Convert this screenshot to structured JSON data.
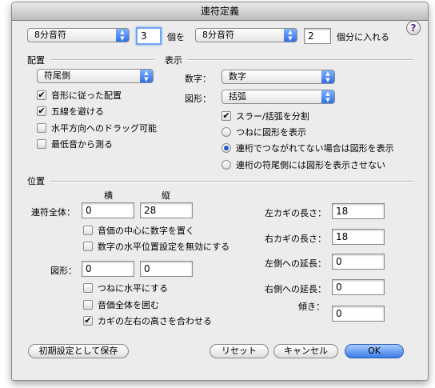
{
  "window": {
    "title": "連符定義"
  },
  "top": {
    "popup1": "8分音符",
    "field1": "3",
    "label_ko": "個を",
    "popup2": "8分音符",
    "field2": "2",
    "label_kobun": "個分に入れる"
  },
  "placement": {
    "header": "配置",
    "popup": "符尾側",
    "checks": [
      {
        "label": "音形に従った配置",
        "checked": true
      },
      {
        "label": "五線を避ける",
        "checked": true
      },
      {
        "label": "水平方向へのドラッグ可能",
        "checked": false
      },
      {
        "label": "最低音から測る",
        "checked": false
      }
    ]
  },
  "display": {
    "header": "表示",
    "number_label": "数字：",
    "number_value": "数字",
    "shape_label": "図形：",
    "shape_value": "括弧",
    "slur_check": {
      "label": "スラー/括弧を分割",
      "checked": true
    },
    "radios": [
      {
        "label": "つねに図形を表示",
        "selected": false
      },
      {
        "label": "連桁でつながれてない場合は図形を表示",
        "selected": true
      },
      {
        "label": "連桁の符尾側には図形を表示させない",
        "selected": false
      }
    ]
  },
  "position": {
    "header": "位置",
    "col_h": "横",
    "col_v": "縦",
    "whole_label": "連符全体：",
    "whole_h": "0",
    "whole_v": "28",
    "whole_checks": [
      {
        "label": "音価の中心に数字を置く",
        "checked": false
      },
      {
        "label": "数字の水平位置設定を無効にする",
        "checked": false
      }
    ],
    "shape_label": "図形：",
    "shape_h": "0",
    "shape_v": "0",
    "shape_checks": [
      {
        "label": "つねに水平にする",
        "checked": false
      },
      {
        "label": "音価全体を囲む",
        "checked": false
      },
      {
        "label": "カギの左右の高さを合わせる",
        "checked": true
      }
    ],
    "left_hook_label": "左カギの長さ：",
    "left_hook": "18",
    "right_hook_label": "右カギの長さ：",
    "right_hook": "18",
    "left_ext_label": "左側への延長：",
    "left_ext": "0",
    "right_ext_label": "右側への延長：",
    "right_ext": "0",
    "slope_label": "傾き：",
    "slope": "0"
  },
  "buttons": {
    "defaults": "初期設定として保存",
    "reset": "リセット",
    "cancel": "キャンセル",
    "ok": "OK"
  },
  "check_glyph": "✔",
  "help_glyph": "?"
}
